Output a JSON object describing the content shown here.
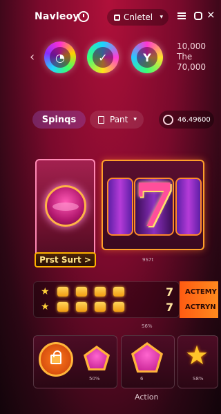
{
  "header": {
    "title": "Navleoy",
    "select_label": "Cnletel",
    "icons": [
      "clock-icon",
      "menu-icon",
      "home-icon",
      "close-icon"
    ]
  },
  "carousel": {
    "items": [
      {
        "symbol": "◔"
      },
      {
        "symbol": "✓"
      },
      {
        "symbol": "Y"
      }
    ],
    "side_numbers": [
      "10,000",
      "The",
      "70,000"
    ]
  },
  "tabs": {
    "spin_label": "Spinqs",
    "pant_label": "Pant"
  },
  "balance": {
    "value": "46.49600"
  },
  "slot": {
    "start_label": "Prst Surt >",
    "reel_symbol": "7",
    "caption": "9S7t"
  },
  "paytable": {
    "rows": [
      {
        "value": "7",
        "action": "ACTEMY"
      },
      {
        "value": "7",
        "action": "ACTRYN"
      }
    ],
    "caption": "S6%"
  },
  "tiles": [
    {
      "caption": "50%"
    },
    {
      "caption": "6"
    },
    {
      "caption": "S8%"
    }
  ],
  "footer": {
    "action_label": "Action"
  },
  "colors": {
    "accent": "#ff8a1e",
    "gold": "#ffb33a",
    "bg": "#7a0a2c"
  }
}
